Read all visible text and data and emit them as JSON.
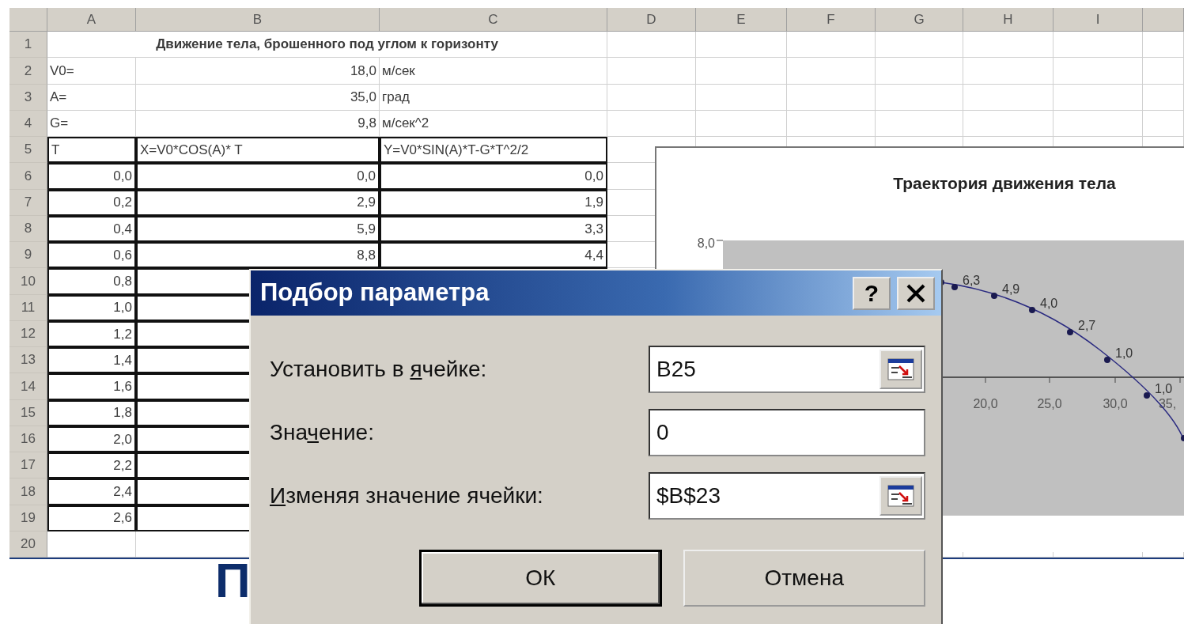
{
  "spreadsheet": {
    "columns": [
      "A",
      "B",
      "C",
      "D",
      "E",
      "F",
      "G",
      "H",
      "I"
    ],
    "rows": [
      {
        "number": "1",
        "kind": "title",
        "cells": [
          "Движение тела, брошенного под углом к горизонту"
        ]
      },
      {
        "number": "2",
        "kind": "param",
        "cells": [
          "V0=",
          "18,0",
          "м/сек"
        ]
      },
      {
        "number": "3",
        "kind": "param",
        "cells": [
          "A=",
          "35,0",
          "град"
        ]
      },
      {
        "number": "4",
        "kind": "param",
        "cells": [
          "G=",
          "9,8",
          "м/сек^2"
        ]
      },
      {
        "number": "5",
        "kind": "header",
        "cells": [
          "T",
          "X=V0*COS(A)* T",
          "Y=V0*SIN(A)*T-G*T^2/2"
        ]
      },
      {
        "number": "6",
        "kind": "data",
        "cells": [
          "0,0",
          "0,0",
          "0,0"
        ]
      },
      {
        "number": "7",
        "kind": "data",
        "cells": [
          "0,2",
          "2,9",
          "1,9"
        ]
      },
      {
        "number": "8",
        "kind": "data",
        "cells": [
          "0,4",
          "5,9",
          "3,3"
        ]
      },
      {
        "number": "9",
        "kind": "data",
        "cells": [
          "0,6",
          "8,8",
          "4,4"
        ]
      },
      {
        "number": "10",
        "kind": "data",
        "cells": [
          "0,8"
        ]
      },
      {
        "number": "11",
        "kind": "data",
        "cells": [
          "1,0"
        ]
      },
      {
        "number": "12",
        "kind": "data",
        "cells": [
          "1,2"
        ]
      },
      {
        "number": "13",
        "kind": "data",
        "cells": [
          "1,4"
        ]
      },
      {
        "number": "14",
        "kind": "data",
        "cells": [
          "1,6"
        ]
      },
      {
        "number": "15",
        "kind": "data",
        "cells": [
          "1,8"
        ]
      },
      {
        "number": "16",
        "kind": "data",
        "cells": [
          "2,0"
        ]
      },
      {
        "number": "17",
        "kind": "data",
        "cells": [
          "2,2"
        ]
      },
      {
        "number": "18",
        "kind": "data",
        "cells": [
          "2,4"
        ]
      },
      {
        "number": "19",
        "kind": "data",
        "cells": [
          "2,6"
        ]
      },
      {
        "number": "20",
        "kind": "empty"
      }
    ]
  },
  "chart": {
    "title": "Траектория движения тела",
    "y_tick_labels": [
      "8,0"
    ],
    "x_tick_labels": [
      "20,0",
      "25,0",
      "30,0",
      "35,"
    ],
    "point_labels": [
      "6,3",
      "4,9",
      "4,0",
      "2,7",
      "1,0",
      "1,0"
    ]
  },
  "dialog": {
    "title": "Подбор параметра",
    "help_button": "?",
    "fields": [
      {
        "kind": "reference",
        "label": {
          "pre": "Установить в ",
          "key": "я",
          "post": "чейке:"
        },
        "value": "B25"
      },
      {
        "kind": "plain",
        "label": {
          "pre": "Зна",
          "key": "ч",
          "post": "ение:"
        },
        "value": "0"
      },
      {
        "kind": "reference",
        "label": {
          "key": "И",
          "post": "зменяя значение ячейки:"
        },
        "value": "$B$23"
      }
    ],
    "buttons": [
      {
        "label": "ОК",
        "default": true
      },
      {
        "label": "Отмена",
        "default": false
      }
    ]
  },
  "slide_fragment": "П"
}
